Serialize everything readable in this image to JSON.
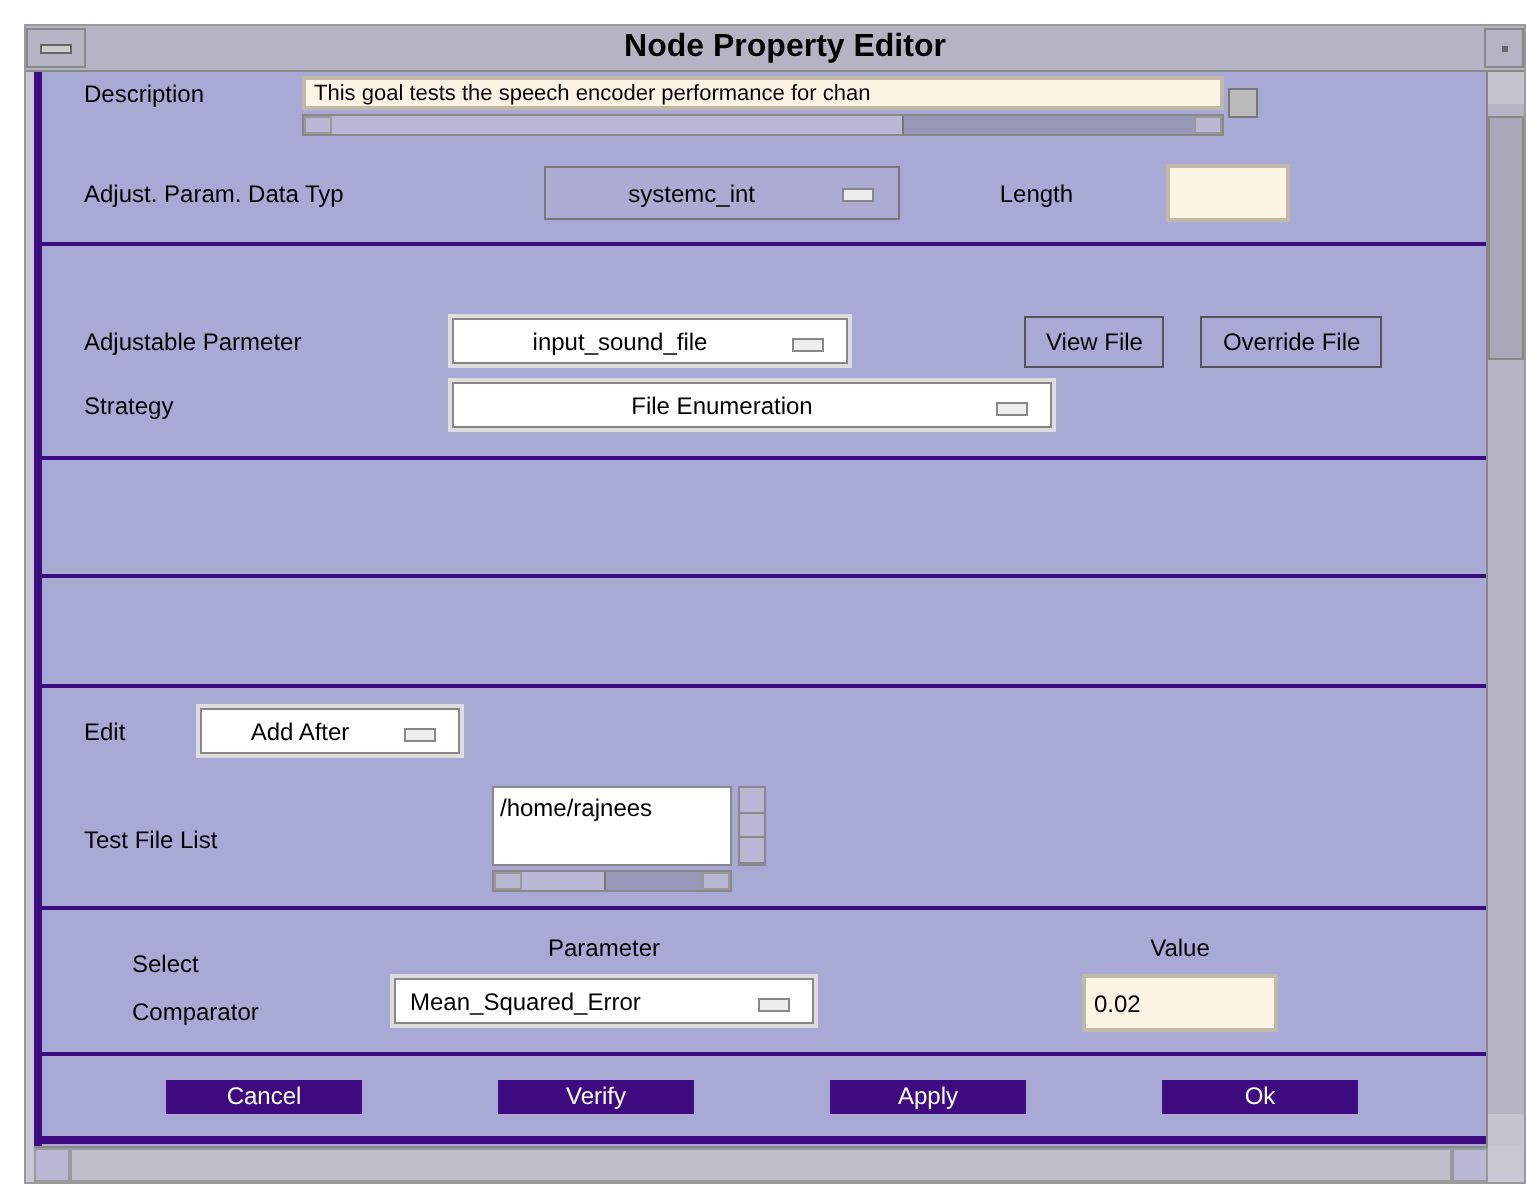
{
  "window": {
    "title": "Node Property Editor"
  },
  "description": {
    "label": "Description",
    "value": "This goal tests the speech encoder performance for chan"
  },
  "data_type": {
    "label": "Adjust. Param. Data Typ",
    "value": "systemc_int"
  },
  "length": {
    "label": "Length"
  },
  "adjustable_parameter": {
    "label": "Adjustable Parmeter",
    "value": "input_sound_file"
  },
  "file_buttons": [
    "View File",
    "Override File"
  ],
  "strategy": {
    "label": "Strategy",
    "value": "File Enumeration"
  },
  "edit": {
    "label": "Edit",
    "value": "Add After"
  },
  "test_file_list": {
    "label": "Test File List",
    "items": [
      "/home/rajnees"
    ]
  },
  "comparator": {
    "label_lines": [
      "Select",
      "Comparator"
    ],
    "parameter_header": "Parameter",
    "value_header": "Value",
    "parameter": "Mean_Squared_Error",
    "value": "0.02"
  },
  "buttons": [
    "Cancel",
    "Verify",
    "Apply",
    "Ok"
  ]
}
